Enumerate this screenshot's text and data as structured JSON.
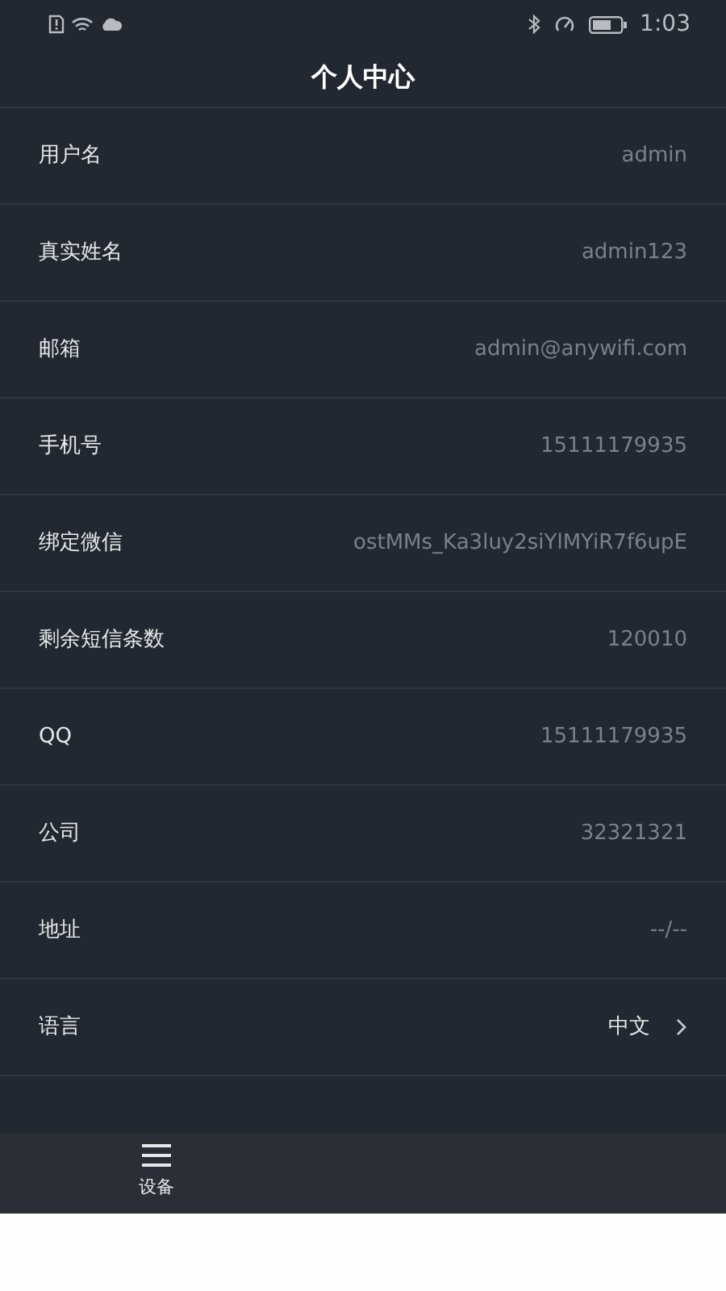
{
  "status_bar": {
    "time": "1:03"
  },
  "title": "个人中心",
  "rows": [
    {
      "kind": "info",
      "label": "用户名",
      "value": "admin"
    },
    {
      "kind": "info",
      "label": "真实姓名",
      "value": "admin123"
    },
    {
      "kind": "info",
      "label": "邮箱",
      "value": "admin@anywifi.com"
    },
    {
      "kind": "info",
      "label": "手机号",
      "value": "15111179935"
    },
    {
      "kind": "info",
      "label": "绑定微信",
      "value": "ostMMs_Ka3luy2siYlMYiR7f6upE"
    },
    {
      "kind": "info",
      "label": "剩余短信条数",
      "value": "120010"
    },
    {
      "kind": "info",
      "label": "QQ",
      "value": "15111179935"
    },
    {
      "kind": "info",
      "label": "公司",
      "value": "32321321"
    },
    {
      "kind": "info",
      "label": "地址",
      "value": "--/--"
    },
    {
      "kind": "nav",
      "label": "语言",
      "value": "中文"
    }
  ],
  "tab_bar": [
    {
      "label": "设备"
    }
  ]
}
